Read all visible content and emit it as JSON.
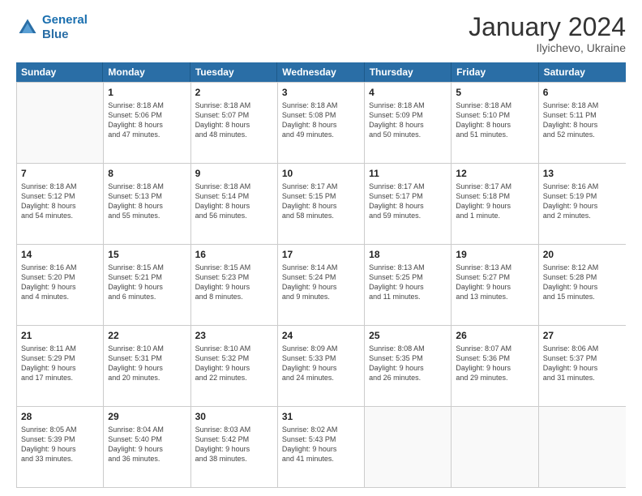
{
  "header": {
    "logo_line1": "General",
    "logo_line2": "Blue",
    "month_title": "January 2024",
    "subtitle": "Ilyichevo, Ukraine"
  },
  "weekdays": [
    "Sunday",
    "Monday",
    "Tuesday",
    "Wednesday",
    "Thursday",
    "Friday",
    "Saturday"
  ],
  "rows": [
    [
      {
        "day": "",
        "sunrise": "",
        "sunset": "",
        "daylight": ""
      },
      {
        "day": "1",
        "sunrise": "Sunrise: 8:18 AM",
        "sunset": "Sunset: 5:06 PM",
        "daylight": "Daylight: 8 hours",
        "daylight2": "and 47 minutes."
      },
      {
        "day": "2",
        "sunrise": "Sunrise: 8:18 AM",
        "sunset": "Sunset: 5:07 PM",
        "daylight": "Daylight: 8 hours",
        "daylight2": "and 48 minutes."
      },
      {
        "day": "3",
        "sunrise": "Sunrise: 8:18 AM",
        "sunset": "Sunset: 5:08 PM",
        "daylight": "Daylight: 8 hours",
        "daylight2": "and 49 minutes."
      },
      {
        "day": "4",
        "sunrise": "Sunrise: 8:18 AM",
        "sunset": "Sunset: 5:09 PM",
        "daylight": "Daylight: 8 hours",
        "daylight2": "and 50 minutes."
      },
      {
        "day": "5",
        "sunrise": "Sunrise: 8:18 AM",
        "sunset": "Sunset: 5:10 PM",
        "daylight": "Daylight: 8 hours",
        "daylight2": "and 51 minutes."
      },
      {
        "day": "6",
        "sunrise": "Sunrise: 8:18 AM",
        "sunset": "Sunset: 5:11 PM",
        "daylight": "Daylight: 8 hours",
        "daylight2": "and 52 minutes."
      }
    ],
    [
      {
        "day": "7",
        "sunrise": "Sunrise: 8:18 AM",
        "sunset": "Sunset: 5:12 PM",
        "daylight": "Daylight: 8 hours",
        "daylight2": "and 54 minutes."
      },
      {
        "day": "8",
        "sunrise": "Sunrise: 8:18 AM",
        "sunset": "Sunset: 5:13 PM",
        "daylight": "Daylight: 8 hours",
        "daylight2": "and 55 minutes."
      },
      {
        "day": "9",
        "sunrise": "Sunrise: 8:18 AM",
        "sunset": "Sunset: 5:14 PM",
        "daylight": "Daylight: 8 hours",
        "daylight2": "and 56 minutes."
      },
      {
        "day": "10",
        "sunrise": "Sunrise: 8:17 AM",
        "sunset": "Sunset: 5:15 PM",
        "daylight": "Daylight: 8 hours",
        "daylight2": "and 58 minutes."
      },
      {
        "day": "11",
        "sunrise": "Sunrise: 8:17 AM",
        "sunset": "Sunset: 5:17 PM",
        "daylight": "Daylight: 8 hours",
        "daylight2": "and 59 minutes."
      },
      {
        "day": "12",
        "sunrise": "Sunrise: 8:17 AM",
        "sunset": "Sunset: 5:18 PM",
        "daylight": "Daylight: 9 hours",
        "daylight2": "and 1 minute."
      },
      {
        "day": "13",
        "sunrise": "Sunrise: 8:16 AM",
        "sunset": "Sunset: 5:19 PM",
        "daylight": "Daylight: 9 hours",
        "daylight2": "and 2 minutes."
      }
    ],
    [
      {
        "day": "14",
        "sunrise": "Sunrise: 8:16 AM",
        "sunset": "Sunset: 5:20 PM",
        "daylight": "Daylight: 9 hours",
        "daylight2": "and 4 minutes."
      },
      {
        "day": "15",
        "sunrise": "Sunrise: 8:15 AM",
        "sunset": "Sunset: 5:21 PM",
        "daylight": "Daylight: 9 hours",
        "daylight2": "and 6 minutes."
      },
      {
        "day": "16",
        "sunrise": "Sunrise: 8:15 AM",
        "sunset": "Sunset: 5:23 PM",
        "daylight": "Daylight: 9 hours",
        "daylight2": "and 8 minutes."
      },
      {
        "day": "17",
        "sunrise": "Sunrise: 8:14 AM",
        "sunset": "Sunset: 5:24 PM",
        "daylight": "Daylight: 9 hours",
        "daylight2": "and 9 minutes."
      },
      {
        "day": "18",
        "sunrise": "Sunrise: 8:13 AM",
        "sunset": "Sunset: 5:25 PM",
        "daylight": "Daylight: 9 hours",
        "daylight2": "and 11 minutes."
      },
      {
        "day": "19",
        "sunrise": "Sunrise: 8:13 AM",
        "sunset": "Sunset: 5:27 PM",
        "daylight": "Daylight: 9 hours",
        "daylight2": "and 13 minutes."
      },
      {
        "day": "20",
        "sunrise": "Sunrise: 8:12 AM",
        "sunset": "Sunset: 5:28 PM",
        "daylight": "Daylight: 9 hours",
        "daylight2": "and 15 minutes."
      }
    ],
    [
      {
        "day": "21",
        "sunrise": "Sunrise: 8:11 AM",
        "sunset": "Sunset: 5:29 PM",
        "daylight": "Daylight: 9 hours",
        "daylight2": "and 17 minutes."
      },
      {
        "day": "22",
        "sunrise": "Sunrise: 8:10 AM",
        "sunset": "Sunset: 5:31 PM",
        "daylight": "Daylight: 9 hours",
        "daylight2": "and 20 minutes."
      },
      {
        "day": "23",
        "sunrise": "Sunrise: 8:10 AM",
        "sunset": "Sunset: 5:32 PM",
        "daylight": "Daylight: 9 hours",
        "daylight2": "and 22 minutes."
      },
      {
        "day": "24",
        "sunrise": "Sunrise: 8:09 AM",
        "sunset": "Sunset: 5:33 PM",
        "daylight": "Daylight: 9 hours",
        "daylight2": "and 24 minutes."
      },
      {
        "day": "25",
        "sunrise": "Sunrise: 8:08 AM",
        "sunset": "Sunset: 5:35 PM",
        "daylight": "Daylight: 9 hours",
        "daylight2": "and 26 minutes."
      },
      {
        "day": "26",
        "sunrise": "Sunrise: 8:07 AM",
        "sunset": "Sunset: 5:36 PM",
        "daylight": "Daylight: 9 hours",
        "daylight2": "and 29 minutes."
      },
      {
        "day": "27",
        "sunrise": "Sunrise: 8:06 AM",
        "sunset": "Sunset: 5:37 PM",
        "daylight": "Daylight: 9 hours",
        "daylight2": "and 31 minutes."
      }
    ],
    [
      {
        "day": "28",
        "sunrise": "Sunrise: 8:05 AM",
        "sunset": "Sunset: 5:39 PM",
        "daylight": "Daylight: 9 hours",
        "daylight2": "and 33 minutes."
      },
      {
        "day": "29",
        "sunrise": "Sunrise: 8:04 AM",
        "sunset": "Sunset: 5:40 PM",
        "daylight": "Daylight: 9 hours",
        "daylight2": "and 36 minutes."
      },
      {
        "day": "30",
        "sunrise": "Sunrise: 8:03 AM",
        "sunset": "Sunset: 5:42 PM",
        "daylight": "Daylight: 9 hours",
        "daylight2": "and 38 minutes."
      },
      {
        "day": "31",
        "sunrise": "Sunrise: 8:02 AM",
        "sunset": "Sunset: 5:43 PM",
        "daylight": "Daylight: 9 hours",
        "daylight2": "and 41 minutes."
      },
      {
        "day": "",
        "sunrise": "",
        "sunset": "",
        "daylight": "",
        "daylight2": ""
      },
      {
        "day": "",
        "sunrise": "",
        "sunset": "",
        "daylight": "",
        "daylight2": ""
      },
      {
        "day": "",
        "sunrise": "",
        "sunset": "",
        "daylight": "",
        "daylight2": ""
      }
    ]
  ]
}
